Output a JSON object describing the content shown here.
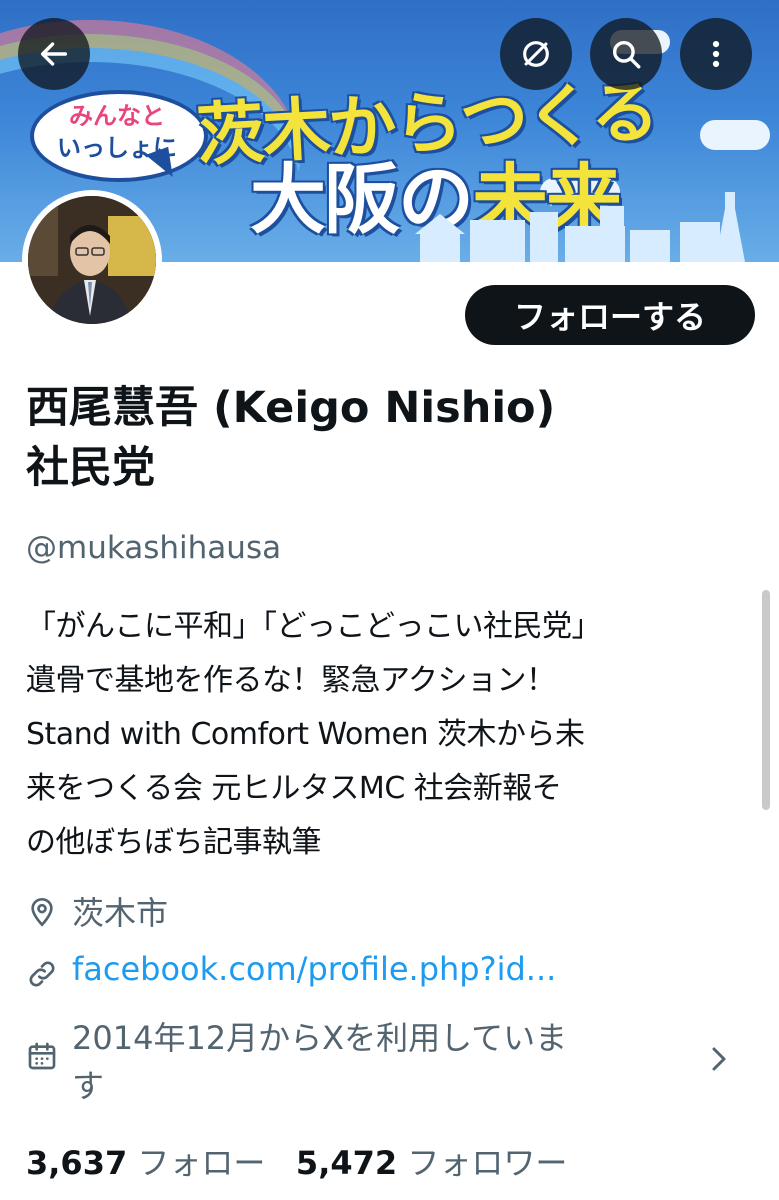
{
  "banner": {
    "bubble_line1": "みんなと",
    "bubble_line2": "いっしょに",
    "slogan_line1": "茨木からつくる",
    "slogan_line2_a": "大阪の",
    "slogan_line2_b": "未来",
    "colors": {
      "sky": "#3d86d8",
      "slogan_yellow": "#f3e33b",
      "outline": "#1d4f9e",
      "pink": "#e8467c"
    }
  },
  "toolbar": {
    "back_icon": "arrow-left-icon",
    "grok_icon": "slash-circle-icon",
    "search_icon": "search-icon",
    "more_icon": "more-vertical-icon"
  },
  "profile": {
    "name_line1": "西尾慧吾 (Keigo Nishio)",
    "name_line2": "社民党",
    "handle": "@mukashihausa",
    "follow_label": "フォローする",
    "bio": [
      "「がんこに平和」「どっこどっこい社民党」",
      "遺骨で基地を作るな！緊急アクション！",
      "Stand with Comfort Women 茨木から未",
      "来をつくる会 元ヒルタスMC 社会新報そ",
      "の他ぼちぼち記事執筆"
    ],
    "location": "茨木市",
    "website": "facebook.com/profile.php?id...",
    "joined_line1": "2014年12月からXを利用していま",
    "joined_line2": "す"
  },
  "stats": {
    "following_count": "3,637",
    "following_label": "フォロー",
    "followers_count": "5,472",
    "followers_label": "フォロワー"
  }
}
